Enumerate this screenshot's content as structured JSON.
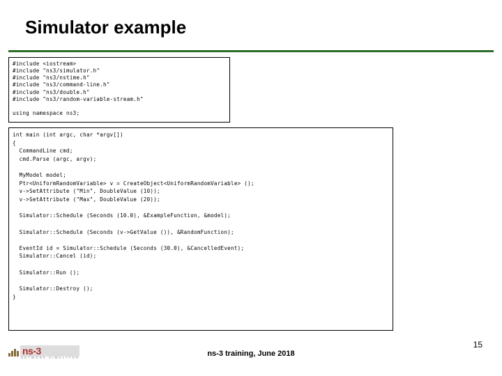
{
  "title": "Simulator example",
  "code_top": "#include <iostream>\n#include \"ns3/simulator.h\"\n#include \"ns3/nstime.h\"\n#include \"ns3/command-line.h\"\n#include \"ns3/double.h\"\n#include \"ns3/random-variable-stream.h\"\n\nusing namespace ns3;",
  "code_bottom": "int main (int argc, char *argv[])\n{\n  CommandLine cmd;\n  cmd.Parse (argc, argv);\n\n  MyModel model;\n  Ptr<UniformRandomVariable> v = CreateObject<UniformRandomVariable> ();\n  v->SetAttribute (\"Min\", DoubleValue (10));\n  v->SetAttribute (\"Max\", DoubleValue (20));\n\n  Simulator::Schedule (Seconds (10.0), &ExampleFunction, &model);\n\n  Simulator::Schedule (Seconds (v->GetValue ()), &RandomFunction);\n\n  EventId id = Simulator::Schedule (Seconds (30.0), &CancelledEvent);\n  Simulator::Cancel (id);\n\n  Simulator::Run ();\n\n  Simulator::Destroy ();\n}",
  "logo": {
    "text": "ns-3",
    "sub": "NETWORK SIMULATOR"
  },
  "footer": "ns-3 training, June 2018",
  "page_number": "15"
}
